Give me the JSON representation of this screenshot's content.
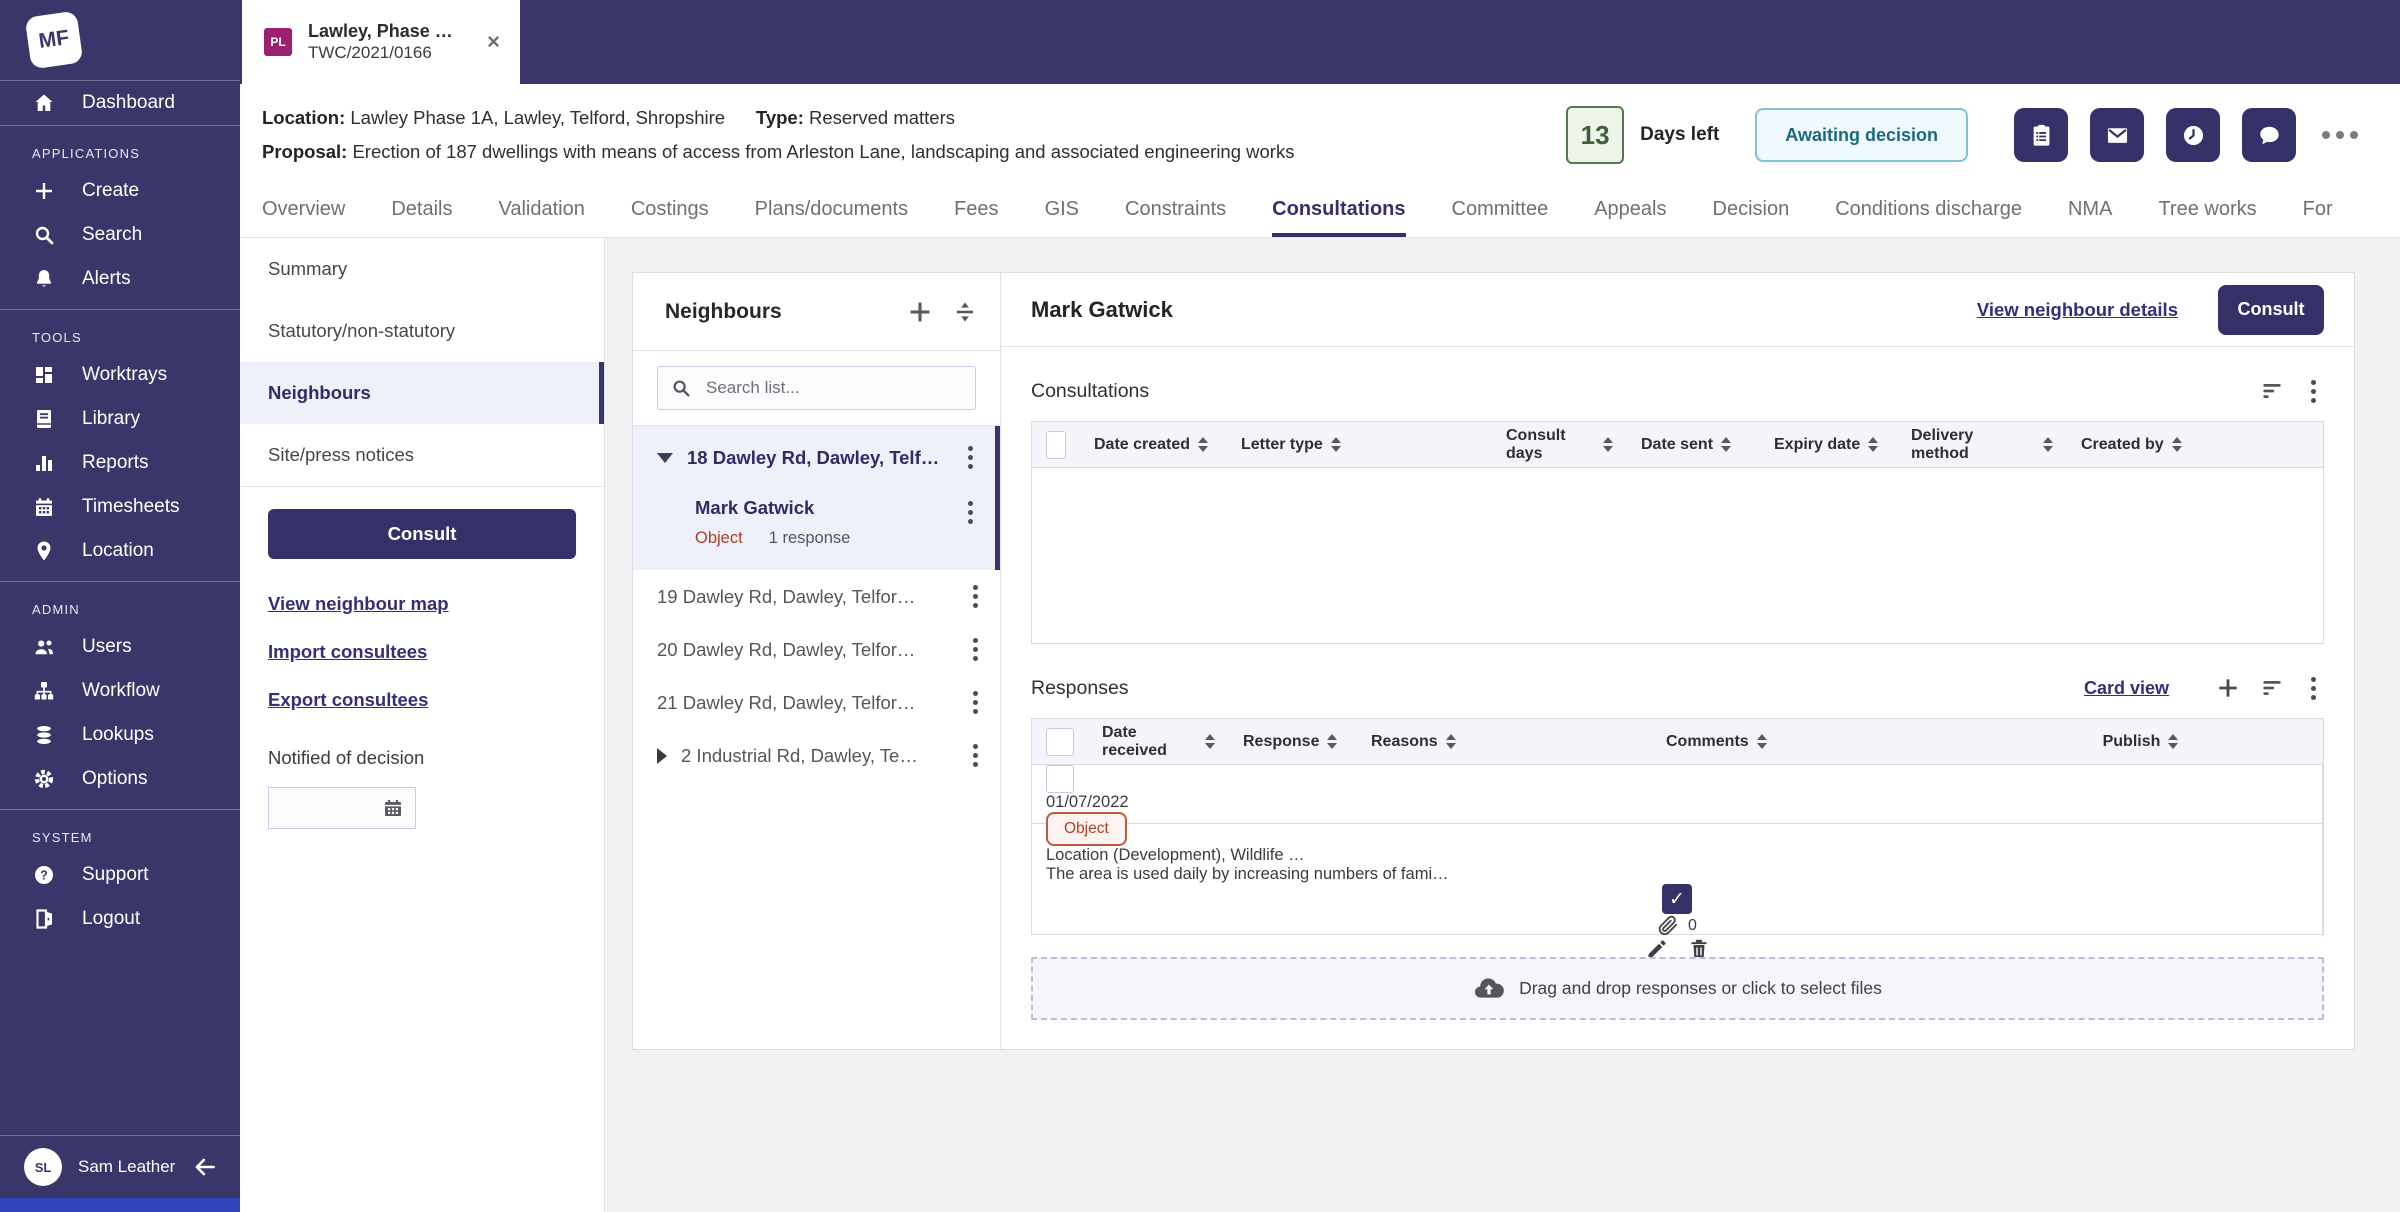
{
  "colors": {
    "navy": "#3a366a",
    "button_navy": "#343169",
    "badge_magenta": "#9c2071",
    "days_green": "#3c6137",
    "status_teal": "#1d6880",
    "object_rust": "#ae3f23",
    "link_indigo": "#32307a"
  },
  "topbar": {
    "logo": "MF",
    "tab": {
      "badge": "PL",
      "title": "Lawley, Phase …",
      "reference": "TWC/2021/0166",
      "close": "×"
    }
  },
  "case_header": {
    "location_label": "Location:",
    "location": "Lawley Phase 1A, Lawley, Telford, Shropshire",
    "type_label": "Type:",
    "type": "Reserved matters",
    "proposal_label": "Proposal:",
    "proposal": "Erection of 187 dwellings with means of access from Arleston Lane, landscaping and associated engineering works",
    "days_left": {
      "value": "13",
      "label": "Days left"
    },
    "status": "Awaiting decision"
  },
  "tabs": {
    "items": [
      "Overview",
      "Details",
      "Validation",
      "Costings",
      "Plans/documents",
      "Fees",
      "GIS",
      "Constraints",
      "Consultations",
      "Committee",
      "Appeals",
      "Decision",
      "Conditions discharge",
      "NMA",
      "Tree works",
      "For"
    ],
    "active": "Consultations"
  },
  "sidebar": {
    "dashboard": "Dashboard",
    "sections": [
      {
        "heading": "APPLICATIONS",
        "items": [
          "Create",
          "Search",
          "Alerts"
        ]
      },
      {
        "heading": "TOOLS",
        "items": [
          "Worktrays",
          "Library",
          "Reports",
          "Timesheets",
          "Location"
        ]
      },
      {
        "heading": "ADMIN",
        "items": [
          "Users",
          "Workflow",
          "Lookups",
          "Options"
        ]
      },
      {
        "heading": "SYSTEM",
        "items": [
          "Support",
          "Logout"
        ]
      }
    ],
    "user": {
      "initials": "SL",
      "name": "Sam Leather"
    }
  },
  "subnav": {
    "items": [
      "Summary",
      "Statutory/non-statutory",
      "Neighbours",
      "Site/press notices"
    ],
    "active": "Neighbours",
    "consult_button": "Consult",
    "links": [
      "View neighbour map",
      "Import consultees",
      "Export consultees"
    ],
    "notified_label": "Notified of decision",
    "notified_date": ""
  },
  "neighbours": {
    "title": "Neighbours",
    "search_placeholder": "Search list...",
    "selected_group": {
      "address": "18 Dawley Rd, Dawley, Telf…",
      "contact": {
        "name": "Mark Gatwick",
        "response": "Object",
        "responses_count": "1 response"
      }
    },
    "other_items": [
      "19 Dawley Rd, Dawley, Telfor…",
      "20 Dawley Rd, Dawley, Telfor…",
      "21 Dawley Rd, Dawley, Telfor…",
      "2 Industrial Rd, Dawley, Te…"
    ]
  },
  "detail": {
    "title": "Mark Gatwick",
    "view_link": "View neighbour details",
    "consult_button": "Consult"
  },
  "consultations": {
    "title": "Consultations",
    "columns": [
      "Date created",
      "Letter type",
      "Consult days",
      "Date sent",
      "Expiry date",
      "Delivery method",
      "Created by"
    ]
  },
  "responses": {
    "title": "Responses",
    "card_view_link": "Card view",
    "columns": [
      "Date received",
      "Response",
      "Reasons",
      "Comments",
      "Publish"
    ],
    "row": {
      "date_received": "01/07/2022",
      "response": "Object",
      "reasons": "Location (Development), Wildlife …",
      "comments": "The area is used daily by increasing numbers of fami…",
      "published": true,
      "attachments": "0"
    },
    "dropzone_text": "Drag and drop responses or click to select files"
  }
}
